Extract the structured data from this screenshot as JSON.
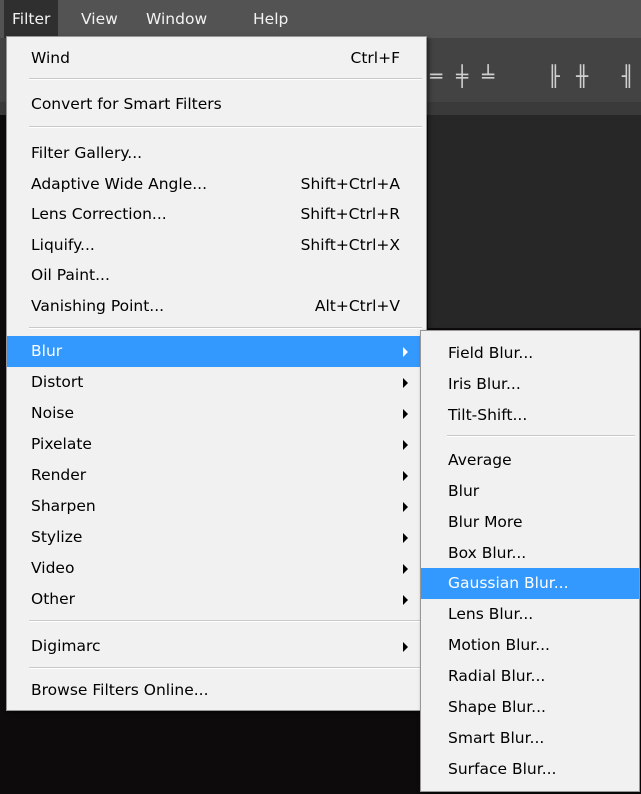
{
  "menubar": {
    "items": [
      "Filter",
      "View",
      "Window",
      "Help"
    ]
  },
  "colors": {
    "highlight": "#3399ff",
    "menu_bg": "#f1f1f1",
    "menubar_bg": "#535353",
    "workspace_bg": "#0d0b0b"
  },
  "options_bar": {
    "icons": [
      "align-top-icon",
      "align-vcenter-icon",
      "align-bottom-icon",
      "distribute-left-icon",
      "distribute-hcenter-icon",
      "distribute-right-icon"
    ]
  },
  "filter_menu": {
    "last_filter": {
      "label": "Wind",
      "shortcut": "Ctrl+F"
    },
    "convert_smart": {
      "label": "Convert for Smart Filters"
    },
    "filter_gallery": {
      "label": "Filter Gallery..."
    },
    "adaptive_wide_angle": {
      "label": "Adaptive Wide Angle...",
      "shortcut": "Shift+Ctrl+A"
    },
    "lens_correction": {
      "label": "Lens Correction...",
      "shortcut": "Shift+Ctrl+R"
    },
    "liquify": {
      "label": "Liquify...",
      "shortcut": "Shift+Ctrl+X"
    },
    "oil_paint": {
      "label": "Oil Paint..."
    },
    "vanishing_point": {
      "label": "Vanishing Point...",
      "shortcut": "Alt+Ctrl+V"
    },
    "submenus": [
      "Blur",
      "Distort",
      "Noise",
      "Pixelate",
      "Render",
      "Sharpen",
      "Stylize",
      "Video",
      "Other"
    ],
    "digimarc": {
      "label": "Digimarc"
    },
    "browse_online": {
      "label": "Browse Filters Online..."
    }
  },
  "blur_submenu": {
    "gallery": [
      "Field Blur...",
      "Iris Blur...",
      "Tilt-Shift..."
    ],
    "items": [
      "Average",
      "Blur",
      "Blur More",
      "Box Blur...",
      "Gaussian Blur...",
      "Lens Blur...",
      "Motion Blur...",
      "Radial Blur...",
      "Shape Blur...",
      "Smart Blur...",
      "Surface Blur..."
    ],
    "highlighted": "Gaussian Blur..."
  }
}
